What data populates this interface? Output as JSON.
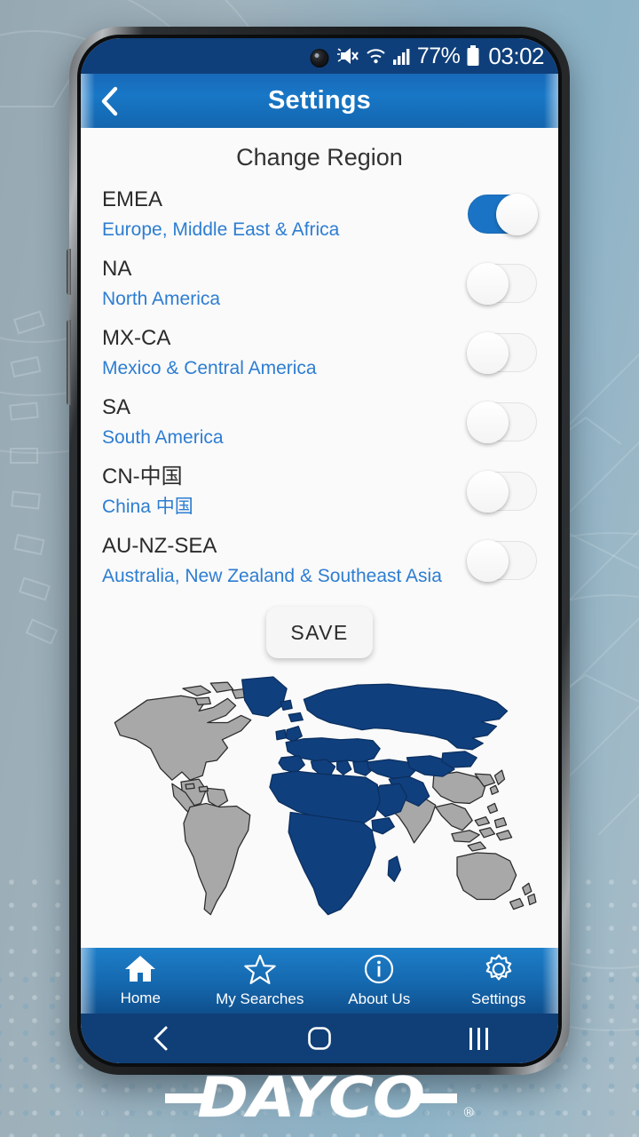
{
  "wallpaper": {
    "brand": "DAYCO",
    "registered": "®"
  },
  "statusbar": {
    "icons": [
      "mute-icon",
      "wifi-icon",
      "signal-icon",
      "battery-icon"
    ],
    "battery_percent": "77%",
    "clock": "03:02"
  },
  "appbar": {
    "back_icon": "chevron-left-icon",
    "title": "Settings"
  },
  "main": {
    "page_title": "Change Region",
    "regions": [
      {
        "code": "EMEA",
        "name": "Europe, Middle East & Africa",
        "enabled": true
      },
      {
        "code": "NA",
        "name": "North America",
        "enabled": false
      },
      {
        "code": "MX-CA",
        "name": "Mexico & Central America",
        "enabled": false
      },
      {
        "code": "SA",
        "name": "South America",
        "enabled": false
      },
      {
        "code": "CN-中国",
        "name": "China 中国",
        "enabled": false
      },
      {
        "code": "AU-NZ-SEA",
        "name": "Australia, New Zealand & Southeast Asia",
        "enabled": false
      }
    ],
    "save_label": "SAVE",
    "map": {
      "highlight_region": "EMEA",
      "highlight_color": "#103f7e",
      "inactive_color": "#a8a8a8"
    }
  },
  "bottomnav": {
    "items": [
      {
        "label": "Home",
        "icon": "home-icon",
        "active": true
      },
      {
        "label": "My Searches",
        "icon": "star-icon",
        "active": false
      },
      {
        "label": "About Us",
        "icon": "info-icon",
        "active": false
      },
      {
        "label": "Settings",
        "icon": "gear-icon",
        "active": false
      }
    ]
  },
  "androidnav": {
    "back": "back-icon",
    "home": "home-square-icon",
    "recents": "recents-icon"
  },
  "colors": {
    "header_blue": "#1877c6",
    "status_blue": "#0f3f7a",
    "link_blue": "#2d7dd2",
    "toggle_on": "#1a73c4",
    "map_navy": "#103f7e"
  }
}
